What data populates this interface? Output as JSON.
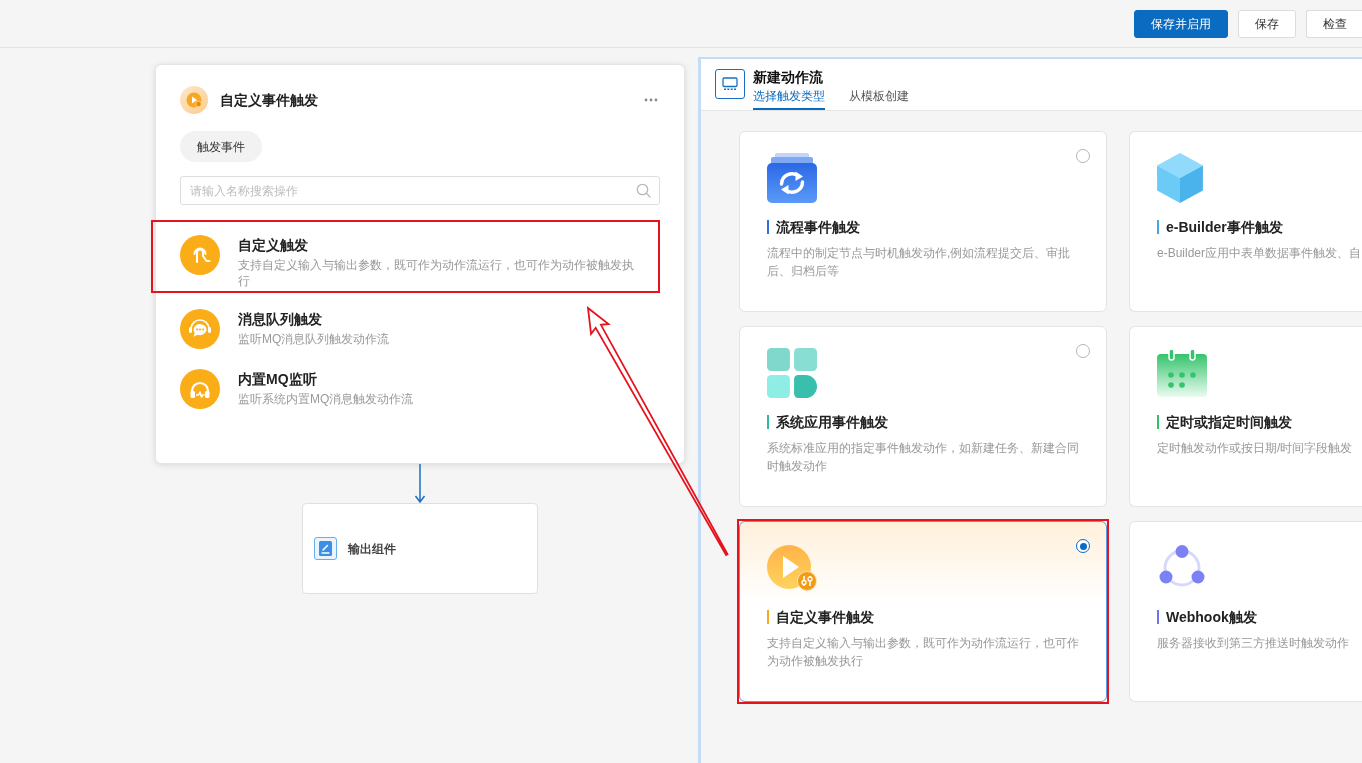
{
  "toolbar": {
    "buttons": [
      {
        "label": "保存并启用",
        "kind": "primary"
      },
      {
        "label": "保存",
        "kind": "default"
      },
      {
        "label": "检查",
        "kind": "default"
      }
    ]
  },
  "trigger_node": {
    "title": "自定义事件触发",
    "tab": "触发事件",
    "search": {
      "placeholder": "请输入名称搜索操作"
    },
    "items": [
      {
        "kind": "custom",
        "title": "自定义触发",
        "description": "支持自定义输入与输出参数，既可作为动作流运行，也可作为动作被触发执行",
        "highlighted": true
      },
      {
        "kind": "queue",
        "title": "消息队列触发",
        "description": "监听MQ消息队列触发动作流",
        "highlighted": false
      },
      {
        "kind": "mq",
        "title": "内置MQ监听",
        "description": "监听系统内置MQ消息触发动作流",
        "highlighted": false
      }
    ]
  },
  "output_node": {
    "title": "输出组件"
  },
  "panel": {
    "title": "新建动作流",
    "tabs": [
      {
        "label": "选择触发类型",
        "selected": true
      },
      {
        "label": "从模板创建",
        "selected": false
      }
    ],
    "cards": [
      {
        "kind": "process",
        "title": "流程事件触发",
        "description": "流程中的制定节点与时机触发动作,例如流程提交后、审批后、归档后等",
        "color": "#2f6fe0",
        "selected": false,
        "highlighted": false
      },
      {
        "kind": "ebuilder",
        "title": "e-Builder事件触发",
        "description": "e-Builder应用中表单数据事件触发、自",
        "color": "#45a6e2",
        "selected": false,
        "highlighted": false
      },
      {
        "kind": "system",
        "title": "系统应用事件触发",
        "description": "系统标准应用的指定事件触发动作，如新建任务、新建合同时触发动作",
        "color": "#30b8a0",
        "selected": false,
        "highlighted": false
      },
      {
        "kind": "schedule",
        "title": "定时或指定时间触发",
        "description": "定时触发动作或按日期/时间字段触发",
        "color": "#2fbf66",
        "selected": false,
        "highlighted": false
      },
      {
        "kind": "custom",
        "title": "自定义事件触发",
        "description": "支持自定义输入与输出参数，既可作为动作流运行，也可作为动作被触发执行",
        "color": "#f5a623",
        "selected": true,
        "highlighted": true
      },
      {
        "kind": "webhook",
        "title": "Webhook触发",
        "description": "服务器接收到第三方推送时触发动作",
        "color": "#6b73ef",
        "selected": false,
        "highlighted": false
      }
    ]
  }
}
